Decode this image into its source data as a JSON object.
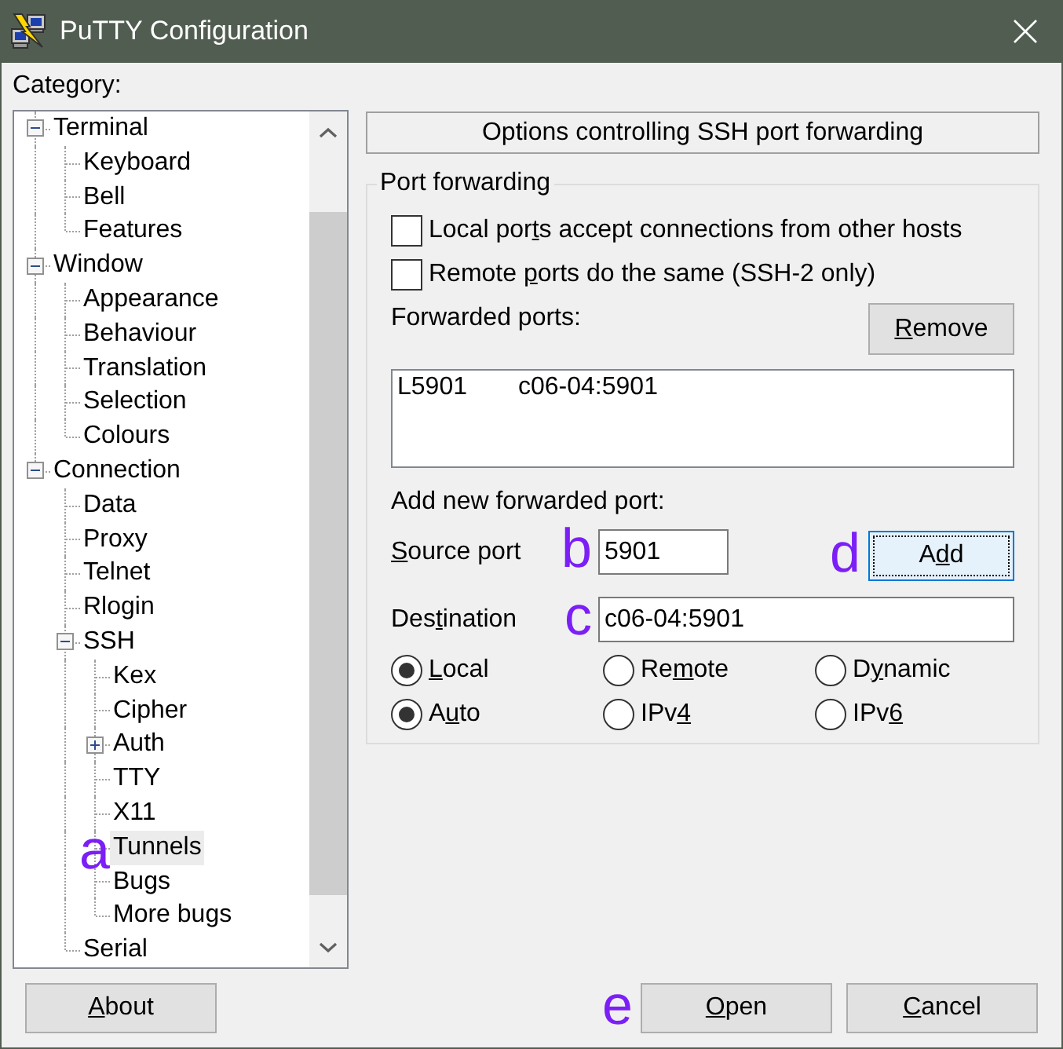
{
  "window": {
    "title": "PuTTY Configuration"
  },
  "category": {
    "label": "Category:",
    "tree": [
      {
        "label": "Terminal",
        "expanded": true,
        "selected": false,
        "children": [
          {
            "label": "Keyboard",
            "selected": false
          },
          {
            "label": "Bell",
            "selected": false
          },
          {
            "label": "Features",
            "selected": false
          }
        ]
      },
      {
        "label": "Window",
        "expanded": true,
        "selected": false,
        "children": [
          {
            "label": "Appearance",
            "selected": false
          },
          {
            "label": "Behaviour",
            "selected": false
          },
          {
            "label": "Translation",
            "selected": false
          },
          {
            "label": "Selection",
            "selected": false
          },
          {
            "label": "Colours",
            "selected": false
          }
        ]
      },
      {
        "label": "Connection",
        "expanded": true,
        "selected": false,
        "children": [
          {
            "label": "Data",
            "selected": false
          },
          {
            "label": "Proxy",
            "selected": false
          },
          {
            "label": "Telnet",
            "selected": false
          },
          {
            "label": "Rlogin",
            "selected": false
          },
          {
            "label": "SSH",
            "expanded": true,
            "selected": false,
            "children": [
              {
                "label": "Kex",
                "selected": false
              },
              {
                "label": "Cipher",
                "selected": false
              },
              {
                "label": "Auth",
                "expanded": false,
                "selected": false
              },
              {
                "label": "TTY",
                "selected": false
              },
              {
                "label": "X11",
                "selected": false
              },
              {
                "label": "Tunnels",
                "selected": true,
                "annotation": "a"
              },
              {
                "label": "Bugs",
                "selected": false
              },
              {
                "label": "More bugs",
                "selected": false
              }
            ]
          },
          {
            "label": "Serial",
            "selected": false
          }
        ]
      }
    ]
  },
  "panel": {
    "header": "Options controlling SSH port forwarding",
    "group": {
      "title": "Port forwarding",
      "checkboxes": [
        {
          "label": {
            "before": "Local por",
            "access_key": "t",
            "after": "s accept connections from other hosts"
          },
          "checked": false
        },
        {
          "label": {
            "before": "Remote ",
            "access_key": "p",
            "after": "orts do the same (SSH-2 only)"
          },
          "checked": false
        }
      ],
      "forwarded_ports_label": "Forwarded ports:",
      "remove_button": {
        "label": {
          "access_key": "R",
          "after": "emove"
        },
        "focused": false
      },
      "forwarded_ports": [
        {
          "source": "L5901",
          "destination": "c06-04:5901",
          "selected": false
        }
      ],
      "add_heading": "Add new forwarded port:",
      "source_port": {
        "label": {
          "access_key": "S",
          "after": "ource port"
        },
        "value": "5901",
        "annotation": "b"
      },
      "destination": {
        "label": {
          "before": "Des",
          "access_key": "t",
          "after": "ination"
        },
        "value": "c06-04:5901",
        "annotation": "c"
      },
      "add_button": {
        "label": {
          "before": "A",
          "access_key": "d",
          "after": "d"
        },
        "focused": true,
        "annotation": "d"
      },
      "radio_groups": [
        {
          "options": [
            {
              "label": {
                "access_key": "L",
                "after": "ocal"
              },
              "selected": true
            },
            {
              "label": {
                "before": "Re",
                "access_key": "m",
                "after": "ote"
              },
              "selected": false
            },
            {
              "label": {
                "before": "D",
                "access_key": "y",
                "after": "namic"
              },
              "selected": false
            }
          ]
        },
        {
          "options": [
            {
              "label": {
                "before": "A",
                "access_key": "u",
                "after": "to"
              },
              "selected": true
            },
            {
              "label": {
                "before": "IPv",
                "access_key": "4"
              },
              "selected": false
            },
            {
              "label": {
                "before": "IPv",
                "access_key": "6"
              },
              "selected": false
            }
          ]
        }
      ]
    }
  },
  "footer": {
    "about_button": {
      "label": {
        "access_key": "A",
        "after": "bout"
      },
      "focused": false
    },
    "open_button": {
      "label": {
        "access_key": "O",
        "after": "pen"
      },
      "focused": false,
      "annotation": "e"
    },
    "cancel_button": {
      "label": {
        "access_key": "C",
        "after": "ancel"
      },
      "focused": false
    }
  }
}
